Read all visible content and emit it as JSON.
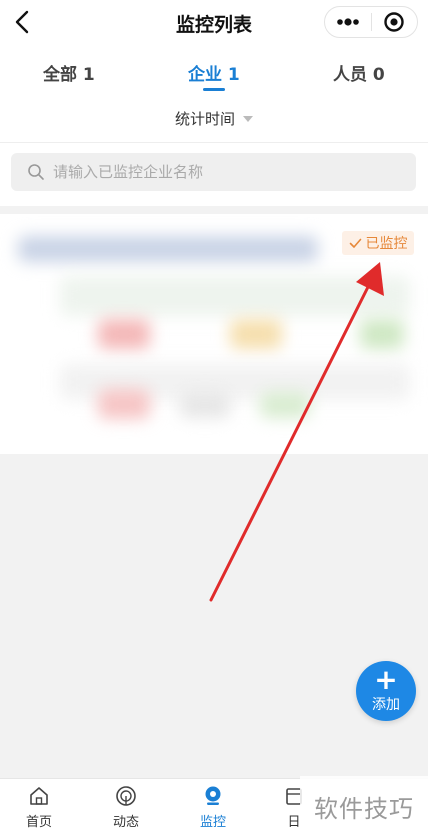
{
  "header": {
    "title": "监控列表",
    "icons": [
      "back-icon",
      "more-dots-icon",
      "target-circle-icon"
    ]
  },
  "tabs": [
    {
      "label": "全部 1"
    },
    {
      "label": "企业 1",
      "active": true
    },
    {
      "label": "人员 0"
    }
  ],
  "filter": {
    "label": "统计时间"
  },
  "search": {
    "placeholder": "请输入已监控企业名称",
    "value": ""
  },
  "card": {
    "badge_label": "已监控"
  },
  "fab": {
    "plus": "+",
    "label": "添加"
  },
  "tabbar": {
    "items": [
      {
        "label": "首页",
        "icon": "home-icon"
      },
      {
        "label": "动态",
        "icon": "radar-icon"
      },
      {
        "label": "监控",
        "icon": "camera-icon",
        "active": true
      },
      {
        "label": "日",
        "icon": "calendar-icon"
      }
    ]
  },
  "watermark": "软件技巧",
  "colors": {
    "accent": "#1a7fd4",
    "badge_text": "#e6883a",
    "badge_bg": "#fdf0e6",
    "fab": "#1e88e5",
    "arrow": "#e02b2b"
  }
}
